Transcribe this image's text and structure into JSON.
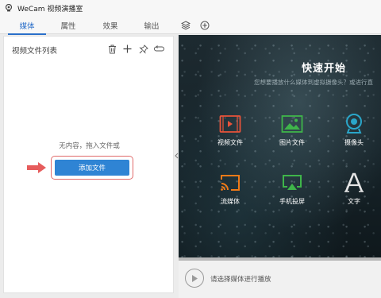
{
  "window": {
    "title": "WeCam 视频演播室"
  },
  "tabs": [
    {
      "label": "媒体",
      "active": true
    },
    {
      "label": "属性",
      "active": false
    },
    {
      "label": "效果",
      "active": false
    },
    {
      "label": "输出",
      "active": false
    }
  ],
  "tab_icons": [
    "layers-icon",
    "add-circle-icon"
  ],
  "media_panel": {
    "title": "视频文件列表",
    "tools": [
      "trash-icon",
      "plus-icon",
      "pin-icon",
      "loop-icon"
    ],
    "empty_text": "无内容，拖入文件或",
    "add_button": "添加文件"
  },
  "preview": {
    "title": "快速开始",
    "subtitle": "您想要播放什么媒体到虚拟摄像头？或进行直",
    "items": [
      {
        "label": "视频文件",
        "icon": "video-file-icon",
        "color": "#e8533a"
      },
      {
        "label": "图片文件",
        "icon": "image-file-icon",
        "color": "#3fb54a"
      },
      {
        "label": "摄像头",
        "icon": "webcam-icon",
        "color": "#2aa6c9"
      },
      {
        "label": "流媒体",
        "icon": "streaming-icon",
        "color": "#f07a18"
      },
      {
        "label": "手机投屏",
        "icon": "screen-mirror-icon",
        "color": "#3fb54a"
      },
      {
        "label": "文字",
        "icon": "text-icon",
        "color": "#e6e6e6"
      }
    ]
  },
  "player": {
    "status": "请选择媒体进行播放"
  },
  "colors": {
    "accent": "#2a6fc9",
    "button": "#2f84d4",
    "highlight": "#e06b6b"
  }
}
